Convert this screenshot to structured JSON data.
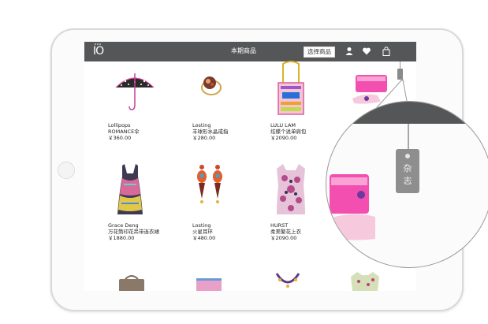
{
  "app": {
    "logo": "IO",
    "title": "本期商品",
    "select_button": "选择商品",
    "icons": [
      "user-icon",
      "heart-icon",
      "shopping-bag-icon"
    ],
    "tag_label_line1": "杂",
    "tag_label_line2": "志"
  },
  "products": [
    {
      "brand": "Lollipops",
      "name": "ROMANCE伞",
      "price": "￥360.00",
      "image": "umbrella"
    },
    {
      "brand": "Losting",
      "name": "丰球形水晶戒指",
      "price": "￥280.00",
      "image": "ring"
    },
    {
      "brand": "LULU LAM",
      "name": "炫蝶个说单肩包",
      "price": "￥2090.00",
      "image": "bag"
    },
    {
      "brand": "Grace Deng",
      "name": "万花筒印花吊带连衣裙",
      "price": "￥1880.00",
      "image": "dress"
    },
    {
      "brand": "Losting",
      "name": "火星耳环",
      "price": "￥480.00",
      "image": "earrings"
    },
    {
      "brand": "HURST",
      "name": "柔美繁花上衣",
      "price": "￥2090.00",
      "image": "top"
    }
  ],
  "colors": {
    "topbar": "#555657",
    "accent_pink": "#e84fa8",
    "tag_gray": "#8e8e8e"
  }
}
